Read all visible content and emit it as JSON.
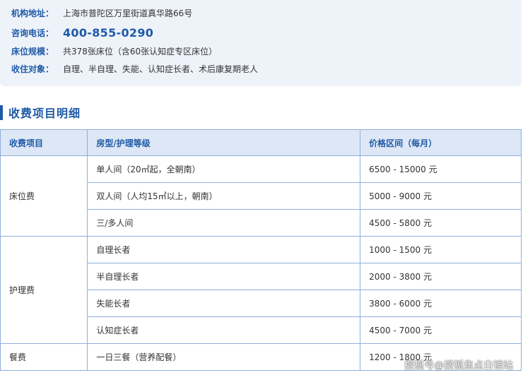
{
  "info": {
    "rows": [
      {
        "label": "机构地址：",
        "value": "上海市普陀区万里街道真华路66号"
      },
      {
        "label": "咨询电话：",
        "value": "400-855-0290"
      },
      {
        "label": "床位规模：",
        "value": "共378张床位（含60张认知症专区床位）"
      },
      {
        "label": "收住对象：",
        "value": "自理、半自理、失能、认知症长者、术后康复期老人"
      }
    ]
  },
  "section": {
    "title": "收费项目明细"
  },
  "table": {
    "headers": [
      "收费项目",
      "房型/护理等级",
      "价格区间（每月）"
    ],
    "groups": [
      {
        "name": "床位费",
        "rows": [
          {
            "type": "单人间（20㎡起，全朝南）",
            "price": "6500 - 15000 元"
          },
          {
            "type": "双人间（人均15㎡以上，朝南）",
            "price": "5000 - 9000 元"
          },
          {
            "type": "三/多人间",
            "price": "4500 - 5800 元"
          }
        ]
      },
      {
        "name": "护理费",
        "rows": [
          {
            "type": "自理长者",
            "price": "1000 - 1500 元"
          },
          {
            "type": "半自理长者",
            "price": "2000 - 3800 元"
          },
          {
            "type": "失能长者",
            "price": "3800 - 6000 元"
          },
          {
            "type": "认知症长者",
            "price": "4500 - 7000 元"
          }
        ]
      },
      {
        "name": "餐费",
        "rows": [
          {
            "type": "一日三餐（营养配餐）",
            "price": "1200 - 1800 元"
          }
        ]
      }
    ]
  },
  "watermark": "搜狐号@搜狐焦点白银站",
  "colors": {
    "accent": "#1f5aa6",
    "info_bg": "#eef3fa",
    "header_bg": "#dde7f5",
    "border": "#8eb0db"
  }
}
